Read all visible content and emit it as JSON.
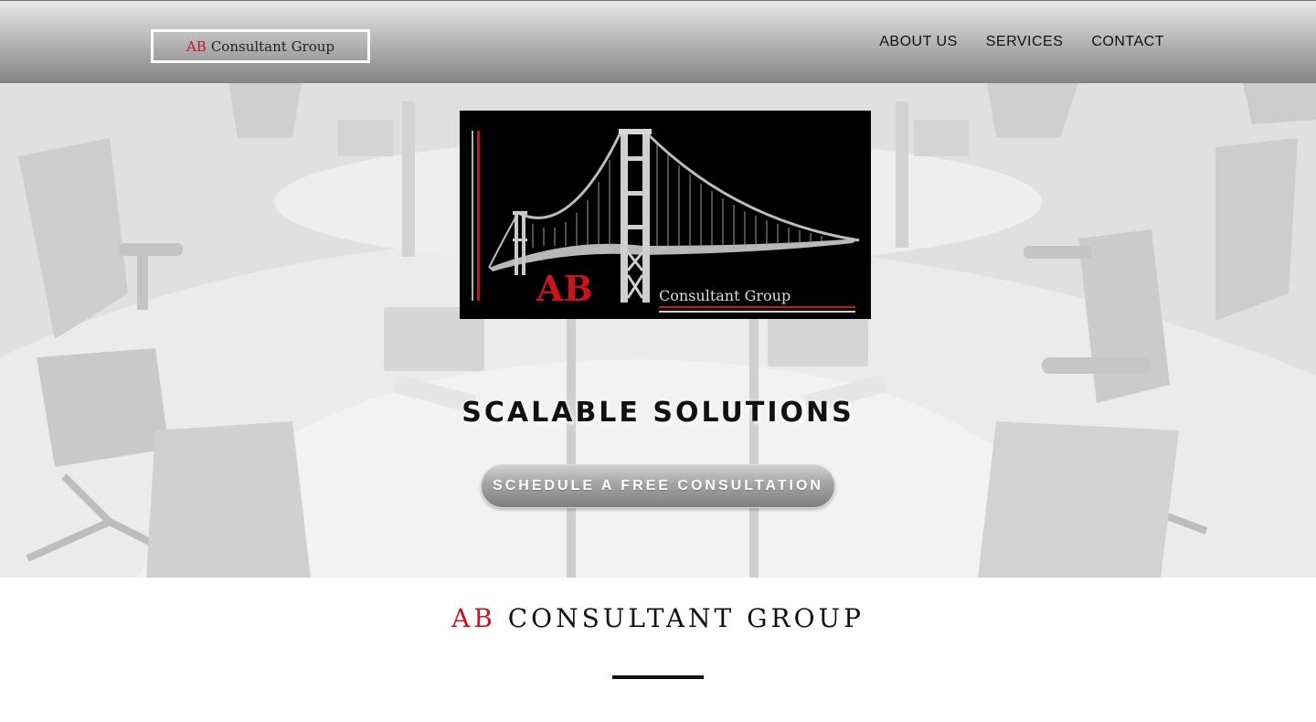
{
  "header": {
    "brand": {
      "ab": "AB",
      "rest": "Consultant Group"
    },
    "nav": [
      "ABOUT US",
      "SERVICES",
      "CONTACT"
    ]
  },
  "hero": {
    "logo": {
      "ab": "AB",
      "text": "Consultant Group"
    },
    "title": "SCALABLE SOLUTIONS",
    "cta": "SCHEDULE A FREE CONSULTATION"
  },
  "section": {
    "title_ab": "AB",
    "title_rest": "CONSULTANT GROUP"
  },
  "colors": {
    "brand_red": "#c8151d",
    "text_dark": "#111111",
    "header_gray": "#9c9c9c"
  }
}
